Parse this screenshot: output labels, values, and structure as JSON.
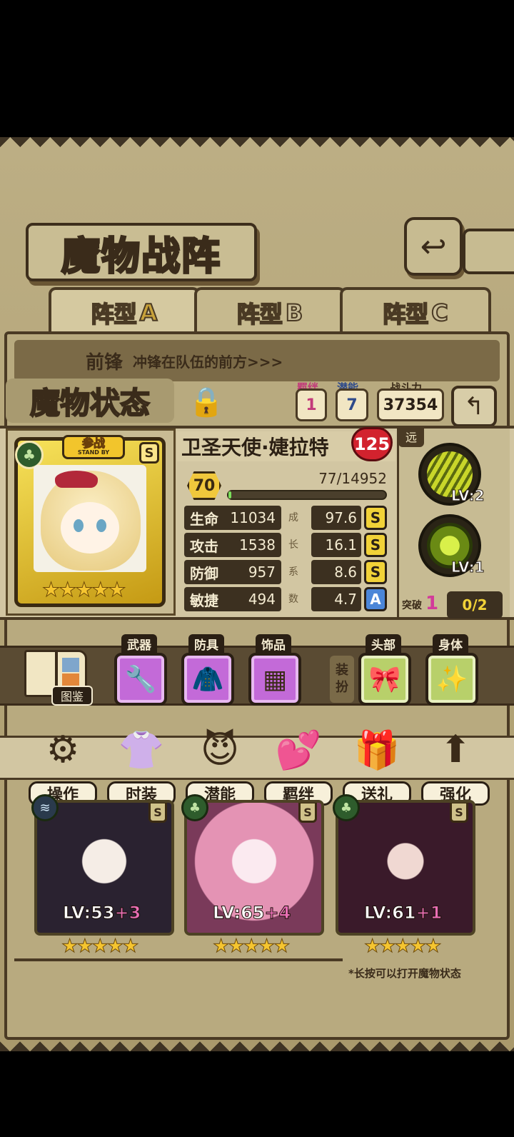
{
  "header": {
    "title": "魔物战阵",
    "back_icon": "back-arrow-icon"
  },
  "formation_tabs": [
    {
      "prefix": "阵型",
      "letter": "A",
      "active": true
    },
    {
      "prefix": "阵型",
      "letter": "B",
      "active": false
    },
    {
      "prefix": "阵型",
      "letter": "C",
      "active": false
    }
  ],
  "vanguard_row": {
    "title": "前锋",
    "desc": "冲锋在队伍的前方>>>"
  },
  "status_panel": {
    "title": "魔物状态",
    "bond_label": "羁绊",
    "bond_value": "1",
    "potential_label": "潜能",
    "potential_value": "7",
    "power_label": "战斗力",
    "power_value": "37354"
  },
  "card": {
    "badge_main": "参战",
    "badge_sub": "STAND BY",
    "rank": "S",
    "stars": "★★★★★"
  },
  "monster": {
    "name": "卫圣天使·婕拉特",
    "heart_value": "125",
    "level": "70",
    "exp_text": "77/14952",
    "exp_fraction": 0.005
  },
  "stats": [
    {
      "name": "生命",
      "value": "11034",
      "growth_char": "成",
      "growth": "97.6",
      "grade": "S"
    },
    {
      "name": "攻击",
      "value": "1538",
      "growth_char": "长",
      "growth": "16.1",
      "grade": "S"
    },
    {
      "name": "防御",
      "value": "957",
      "growth_char": "系",
      "growth": "8.6",
      "grade": "S"
    },
    {
      "name": "敏捷",
      "value": "494",
      "growth_char": "数",
      "growth": "4.7",
      "grade": "A"
    }
  ],
  "side": {
    "range_tag": "远",
    "skill1_lv": "LV:2",
    "skill2_lv": "LV:1",
    "break_label": "突破",
    "break_num": "1",
    "break_progress": "0/2"
  },
  "equipment": {
    "book_label": "图鉴",
    "weapon_label": "武器",
    "armor_label": "防具",
    "accessory_label": "饰品",
    "dress_tag": "装扮",
    "head_label": "头部",
    "body_label": "身体"
  },
  "menu": [
    {
      "label": "操作",
      "icon": "gear-icon"
    },
    {
      "label": "时装",
      "icon": "outfit-icon"
    },
    {
      "label": "潜能",
      "icon": "demon-icon"
    },
    {
      "label": "羁绊",
      "icon": "heart-icon"
    },
    {
      "label": "送礼",
      "icon": "gift-icon"
    },
    {
      "label": "强化",
      "icon": "up-arrow-icon"
    }
  ],
  "roster": [
    {
      "lv": "LV:53",
      "plus": "+3",
      "rank": "S",
      "stars": "★★★★★"
    },
    {
      "lv": "LV:65",
      "plus": "+4",
      "rank": "S",
      "stars": "★★★★★"
    },
    {
      "lv": "LV:61",
      "plus": "+1",
      "rank": "S",
      "stars": "★★★★★"
    }
  ],
  "hint": "*长按可以打开魔物状态",
  "colors": {
    "accent_gold": "#f1c83c",
    "panel_dark": "#3c3020",
    "bond_pink": "#c23a7a"
  }
}
